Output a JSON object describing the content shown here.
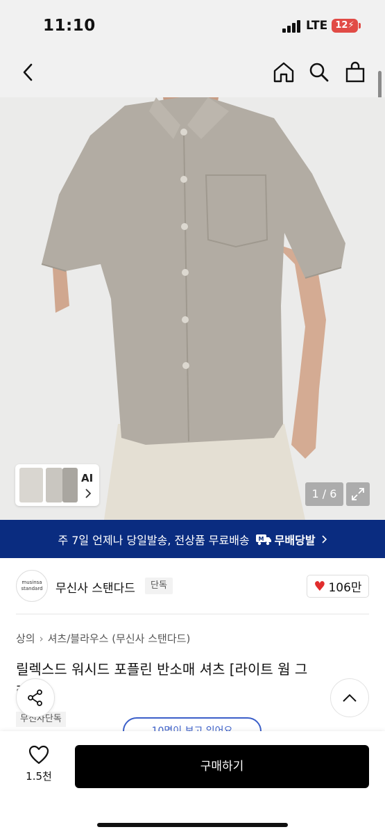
{
  "status_bar": {
    "time": "11:10",
    "network": "LTE",
    "battery": "12"
  },
  "brand": {
    "name": "무신사 스탠다드",
    "badge": "단독",
    "logo_line1": "musinsa",
    "logo_line2": "standard"
  },
  "likes": {
    "count": "106만"
  },
  "gallery": {
    "counter": "1 / 6",
    "ai_label": "AI"
  },
  "banner": {
    "text": "주 7일 언제나 당일발송, 전상품 무료배송",
    "brand_mark": "무배당발",
    "accent": "#0a2c80"
  },
  "breadcrumb": {
    "items": [
      "상의",
      "셔츠/블라우스 (무신사 스탠다드)"
    ]
  },
  "product": {
    "title": "릴렉스드 워시드 포플린 반소매 셔츠 [라이트 웜 그",
    "title_cont": "레",
    "tag": "무신사단독"
  },
  "viewers": {
    "text": "10명이 보고 있어요"
  },
  "bottom": {
    "wish_count": "1.5천",
    "buy_label": "구매하기"
  },
  "icons": [
    "back-icon",
    "home-icon",
    "search-icon",
    "bag-icon",
    "chevron-right-icon",
    "expand-icon",
    "heart-icon",
    "share-icon",
    "chevron-up-icon"
  ]
}
